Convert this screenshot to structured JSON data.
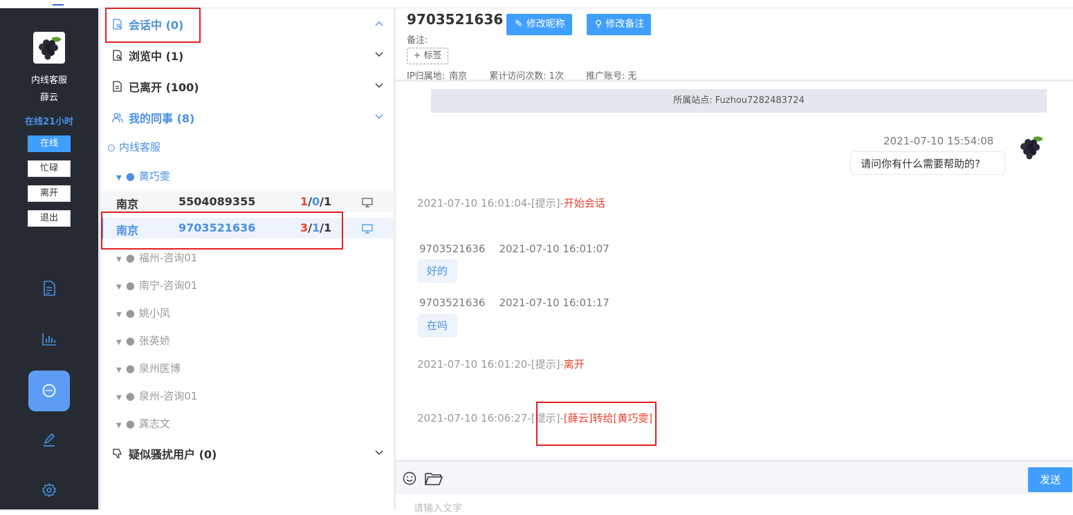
{
  "sidebar": {
    "role": "内线客服",
    "name": "薛云",
    "online_time": "在线21小时",
    "statuses": [
      "在线",
      "忙碌",
      "离开",
      "退出"
    ],
    "active_status": "在线",
    "nav_icons": [
      "document-icon",
      "bar-chart-icon",
      "chat-icon",
      "edit-icon",
      "settings-icon"
    ],
    "active_nav": "chat-icon"
  },
  "sections": {
    "in_session": {
      "label": "会话中",
      "count": "(0)"
    },
    "browsing": {
      "label": "浏览中",
      "count": "(1)"
    },
    "left": {
      "label": "已离开",
      "count": "(100)"
    },
    "colleagues": {
      "label": "我的同事",
      "count": "(8)"
    },
    "harassment": {
      "label": "疑似骚扰用户",
      "count": "(0)"
    }
  },
  "colleague_groups": {
    "group_name": "内线客服",
    "expanded_member": "黄巧雯",
    "visitors": [
      {
        "city": "南京",
        "id": "5504089355",
        "a": "1",
        "b": "0",
        "c": "1"
      },
      {
        "city": "南京",
        "id": "9703521636",
        "a": "3",
        "b": "1",
        "c": "1"
      }
    ],
    "members": [
      "福州-咨询01",
      "南宁-咨询01",
      "姚小凤",
      "张英娇",
      "泉州医博",
      "泉州-咨询01",
      "龚志文"
    ]
  },
  "header": {
    "title": "9703521636",
    "btn_nickname": "修改昵称",
    "btn_note": "修改备注",
    "note_label": "备注:",
    "tag_label": "+ 标签",
    "ip_label": "IP归属地:",
    "ip_value": "南京",
    "visits_label": "累计访问次数:",
    "visits_value": "1次",
    "promo_label": "推广账号:",
    "promo_value": "无"
  },
  "chat": {
    "site": "所属站点:  Fuzhou7282483724",
    "out_time": "2021-07-10 15:54:08",
    "out_msg": "请问你有什么需要帮助的?",
    "hint1_prefix": "2021-07-10 16:01:04-[提示]-",
    "hint1_text": "开始会话",
    "in1_sender": "9703521636",
    "in1_time": "2021-07-10 16:01:07",
    "in1_msg": "好的",
    "in2_sender": "9703521636",
    "in2_time": "2021-07-10 16:01:17",
    "in2_msg": "在吗",
    "hint2_prefix": "2021-07-10 16:01:20-[提示]-",
    "hint2_text": "离开",
    "hint3_prefix": "2021-07-10 16:06:27-[提示]-",
    "hint3_text": "[薛云]转给[黄巧雯]"
  },
  "composer": {
    "send_label": "发送",
    "placeholder": "请输入文字"
  },
  "colors": {
    "sidebar_bg": "#262b33",
    "primary": "#409eff",
    "accent_blue": "#4a90e2",
    "highlight_red": "#e02020"
  }
}
